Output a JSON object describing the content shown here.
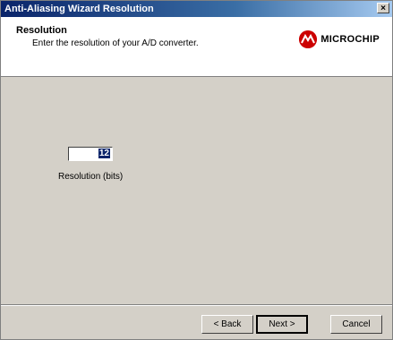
{
  "window": {
    "title": "Anti-Aliasing Wizard Resolution",
    "close_label": "×"
  },
  "header": {
    "title": "Resolution",
    "subtitle": "Enter the resolution of your A/D converter.",
    "logo_text": "MICROCHIP",
    "logo_color": "#cc0000"
  },
  "form": {
    "resolution_value": "12",
    "resolution_label": "Resolution (bits)"
  },
  "buttons": {
    "back": "< Back",
    "next": "Next >",
    "cancel": "Cancel"
  }
}
